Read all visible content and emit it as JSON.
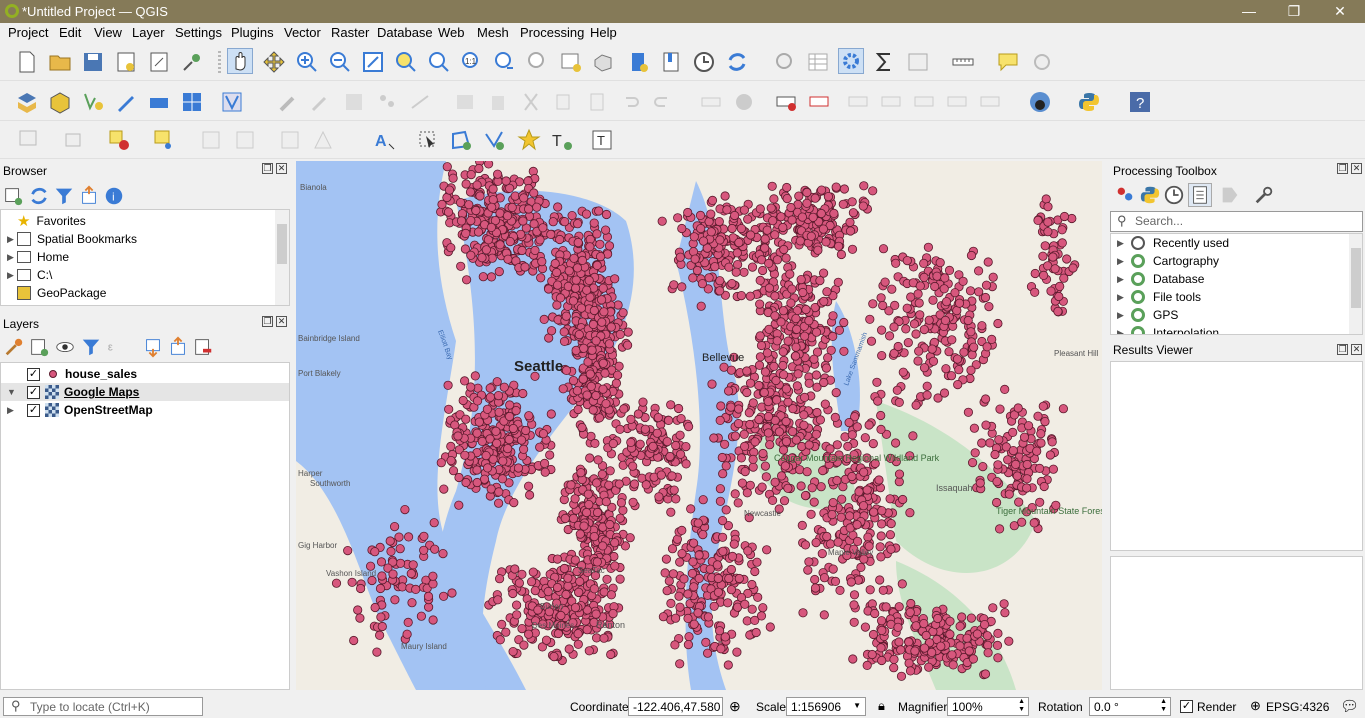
{
  "window": {
    "title": "*Untitled Project — QGIS",
    "minimize": "—",
    "maximize": "❐",
    "close": "✕"
  },
  "menu": [
    "Project",
    "Edit",
    "View",
    "Layer",
    "Settings",
    "Plugins",
    "Vector",
    "Raster",
    "Database",
    "Web",
    "Mesh",
    "Processing",
    "Help"
  ],
  "browser": {
    "title": "Browser",
    "items": [
      "Favorites",
      "Spatial Bookmarks",
      "Home",
      "C:\\",
      "GeoPackage"
    ]
  },
  "layers": {
    "title": "Layers",
    "items": [
      {
        "name": "house_sales",
        "checked": "✓"
      },
      {
        "name": "Google Maps",
        "checked": "✓"
      },
      {
        "name": "OpenStreetMap",
        "checked": "✓"
      }
    ]
  },
  "processing": {
    "title": "Processing Toolbox",
    "search_placeholder": "Search...",
    "items": [
      "Recently used",
      "Cartography",
      "Database",
      "File tools",
      "GPS",
      "Interpolation"
    ]
  },
  "results": {
    "title": "Results Viewer"
  },
  "map_labels": [
    "Bianola",
    "Seattle",
    "Bellevue",
    "Vashon Island",
    "Maury Island",
    "Port Blakely",
    "Southworth",
    "Harper",
    "Tiger Mountain State Forest",
    "Cougar Mountain Regional Wildland Park",
    "Lake Sammamish",
    "Elliott Bay",
    "Bainbridge Island",
    "Burien",
    "SeaTac",
    "Renton",
    "Maple Valley",
    "Newcastle",
    "Issaquah",
    "Pleasant Hill",
    "Des Moines",
    "Gig Harbor"
  ],
  "colors": {
    "point_fill": "#d7577d",
    "point_stroke": "#5a1a2c",
    "water": "#a3c3f3",
    "land": "#f1ede4",
    "park": "#c9e4c7",
    "titlebar": "#857a58"
  },
  "status": {
    "locate_placeholder": "Type to locate (Ctrl+K)",
    "coordinate_label": "Coordinate",
    "coordinate_value": "-122.406,47.580",
    "scale_label": "Scale",
    "scale_value": "1:156906",
    "magnifier_label": "Magnifier",
    "magnifier_value": "100%",
    "rotation_label": "Rotation",
    "rotation_value": "0.0 °",
    "render_label": "Render",
    "render_checked": "✓",
    "crs": "EPSG:4326"
  }
}
